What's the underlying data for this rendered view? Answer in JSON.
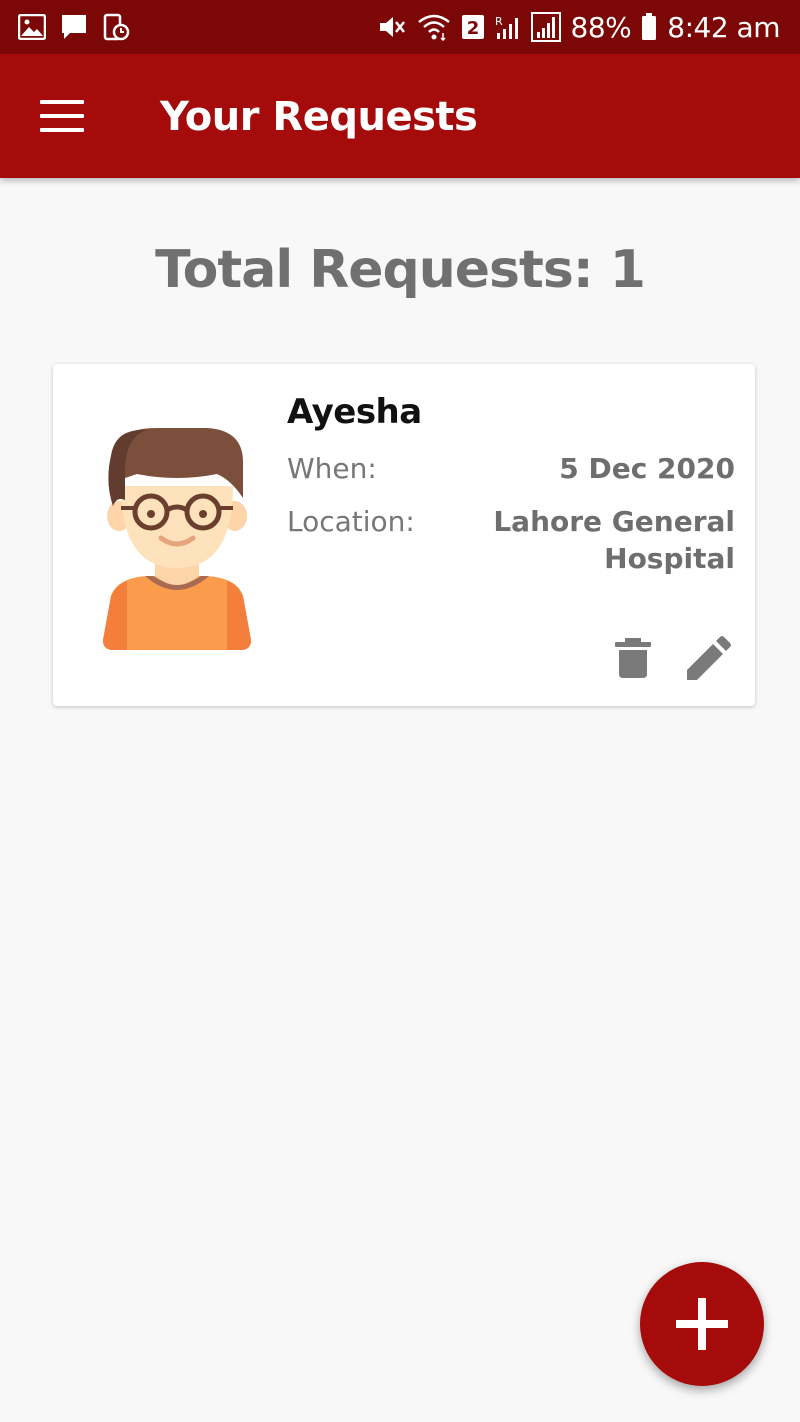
{
  "status_bar": {
    "battery_percent": "88%",
    "time": "8:42 am",
    "sim_badge": "2",
    "left_icons": [
      "gallery-icon",
      "message-icon",
      "screenshot-icon"
    ],
    "right_icons": [
      "mute-icon",
      "wifi-icon",
      "sim-badge-icon",
      "signal-r-icon",
      "signal-icon",
      "battery-icon"
    ]
  },
  "app_bar": {
    "title": "Your Requests",
    "menu_icon": "menu-icon"
  },
  "main": {
    "total_label": "Total Requests: 1",
    "requests": [
      {
        "name": "Ayesha",
        "when_label": "When:",
        "when_value": "5 Dec 2020",
        "location_label": "Location:",
        "location_value": "Lahore General Hospital",
        "avatar_icon": "person-avatar",
        "actions": [
          "delete-icon",
          "edit-icon"
        ]
      }
    ]
  },
  "fab": {
    "icon": "plus-icon"
  },
  "colors": {
    "status_bar": "#7c0707",
    "app_bar": "#a50b0b",
    "accent": "#a50b0b",
    "background": "#f8f8f8",
    "heading_text": "#707070"
  }
}
